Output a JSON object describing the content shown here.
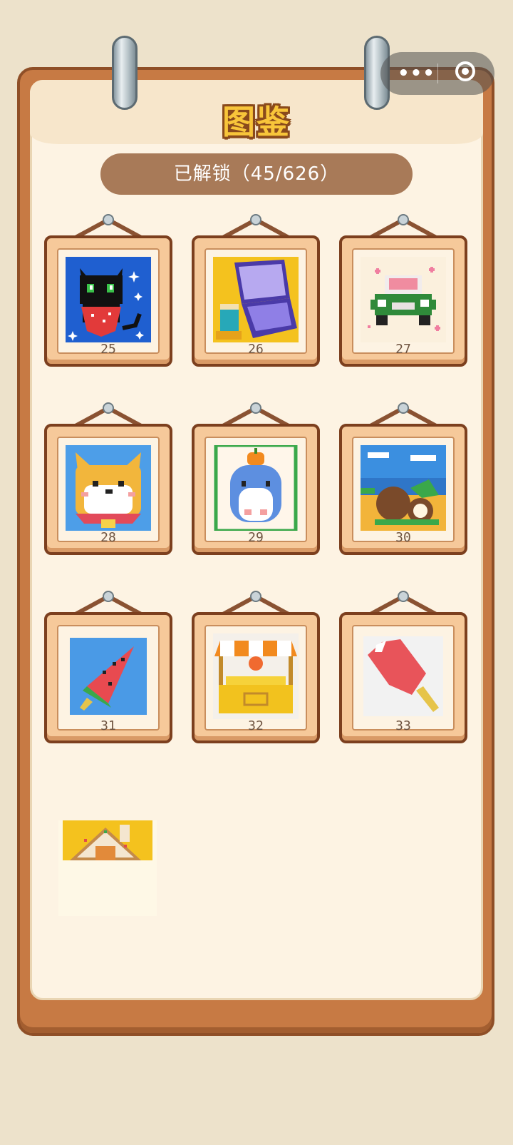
{
  "title": "图鉴",
  "unlocked_label": "已解锁（45/626）",
  "capsule": {
    "more": "•••",
    "close_icon": "target-icon"
  },
  "artworks": [
    {
      "num": "25",
      "name": "black-cat-strawberry"
    },
    {
      "num": "26",
      "name": "laptop-desk"
    },
    {
      "num": "27",
      "name": "green-van"
    },
    {
      "num": "28",
      "name": "shiba-dog"
    },
    {
      "num": "29",
      "name": "hamster-pumpkin"
    },
    {
      "num": "30",
      "name": "coconut-beach"
    },
    {
      "num": "31",
      "name": "watermelon-popsicle"
    },
    {
      "num": "32",
      "name": "market-stall"
    },
    {
      "num": "33",
      "name": "red-popsicle"
    }
  ],
  "colors": {
    "title": "#f8c53a",
    "badge": "#a87a58",
    "frame": "#f6c99a"
  }
}
